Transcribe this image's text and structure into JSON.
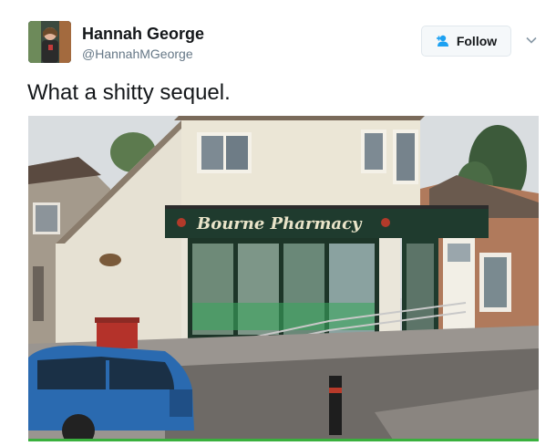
{
  "author": {
    "name": "Hannah George",
    "handle": "@HannahMGeorge"
  },
  "follow_button": {
    "label": "Follow",
    "icon": "add-user-icon"
  },
  "menu_icon": "chevron-down-icon",
  "tweet": {
    "text": "What a shitty sequel."
  },
  "photo": {
    "sign_text": "Bourne Pharmacy"
  },
  "colors": {
    "follow_text": "#14171a",
    "follow_icon": "#1da1f2",
    "handle": "#657786",
    "shopfront": "#1f3b2e"
  }
}
